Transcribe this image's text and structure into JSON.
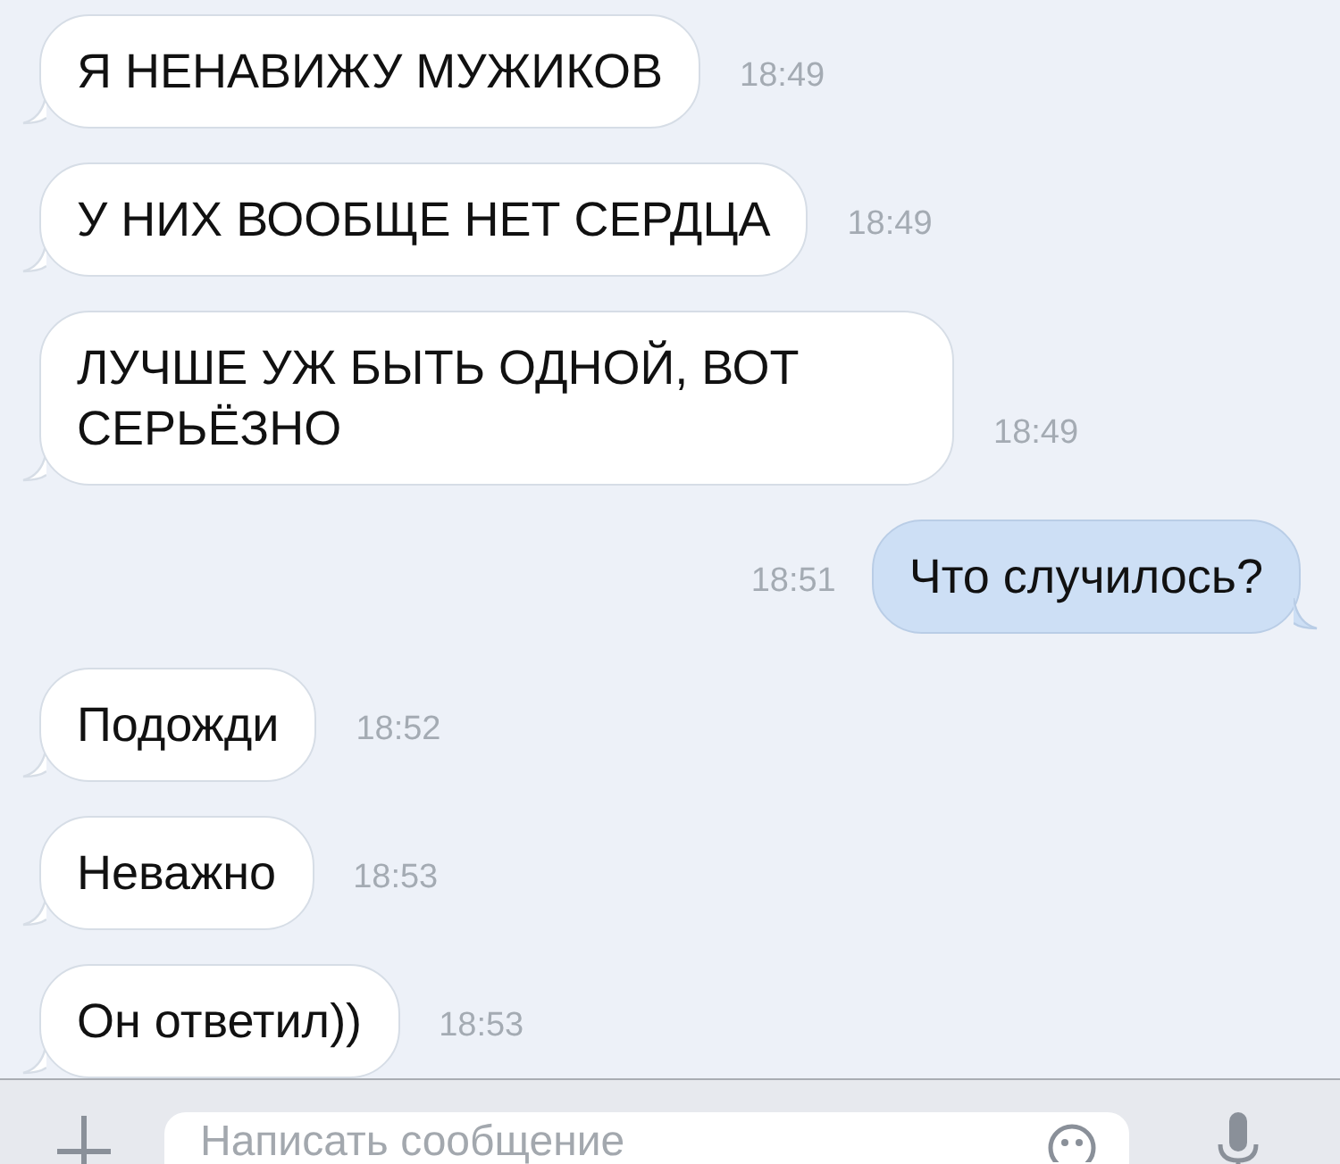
{
  "messages": [
    {
      "kind": "incoming",
      "text": "Я НЕНАВИЖУ МУЖИКОВ",
      "time": "18:49"
    },
    {
      "kind": "incoming",
      "text": "У НИХ ВООБЩЕ НЕТ СЕРДЦА",
      "time": "18:49"
    },
    {
      "kind": "incoming",
      "text": "ЛУЧШЕ УЖ БЫТЬ ОДНОЙ, ВОТ СЕРЬЁЗНО",
      "time": "18:49"
    },
    {
      "kind": "outgoing",
      "text": "Что случилось?",
      "time": "18:51"
    },
    {
      "kind": "incoming",
      "text": "Подожди",
      "time": "18:52"
    },
    {
      "kind": "incoming",
      "text": "Неважно",
      "time": "18:53"
    },
    {
      "kind": "incoming",
      "text": "Он ответил))",
      "time": "18:53"
    }
  ],
  "composer": {
    "placeholder": "Написать сообщение"
  }
}
